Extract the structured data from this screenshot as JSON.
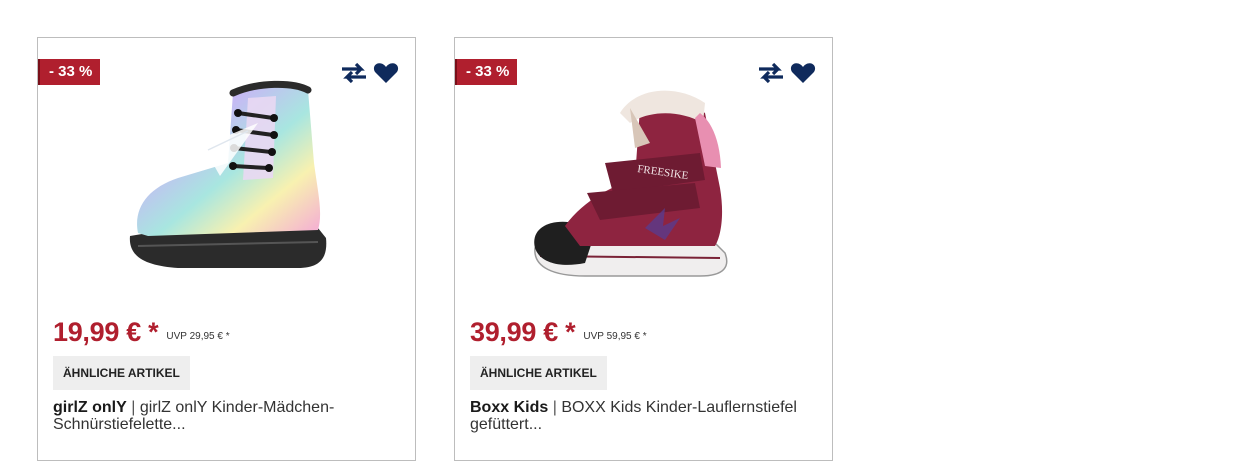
{
  "products": [
    {
      "discount": "- 33 %",
      "price": "19,99 € *",
      "uvp": "UVP 29,95 € *",
      "similar_label": "ÄHNLICHE ARTIKEL",
      "brand": "girlZ onlY",
      "separator": "|",
      "name_line1": "girlZ onlY Kinder-Mädchen-",
      "name_line2": "Schnürstiefelette..."
    },
    {
      "discount": "- 33 %",
      "price": "39,99 € *",
      "uvp": "UVP 59,95 € *",
      "similar_label": "ÄHNLICHE ARTIKEL",
      "brand": "Boxx Kids",
      "separator": "|",
      "name_line1": "BOXX Kids Kinder-Lauflernstiefel",
      "name_line2": "gefüttert...",
      "shoe_logo_text": "FREESIKE"
    }
  ],
  "icons": {
    "compare": "compare-arrows-icon",
    "wishlist": "heart-icon"
  },
  "colors": {
    "sale_red": "#b01f2e",
    "icon_navy": "#0f2a5c",
    "chip_bg": "#eeeeee",
    "border": "#bdbdbd"
  }
}
